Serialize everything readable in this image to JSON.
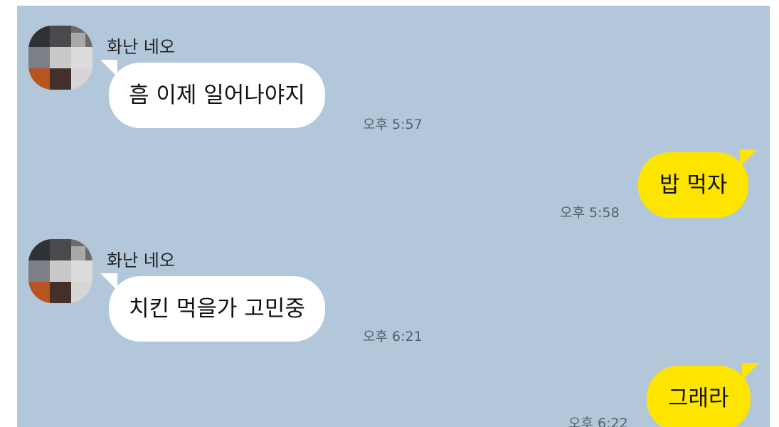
{
  "chat": {
    "messages": [
      {
        "direction": "incoming",
        "sender": "화난 네오",
        "text": "흠 이제 일어나야지",
        "time": "오후 5:57"
      },
      {
        "direction": "outgoing",
        "text": "밥 먹자",
        "time": "오후 5:58"
      },
      {
        "direction": "incoming",
        "sender": "화난 네오",
        "text": "치킨 먹을가 고민중",
        "time": "오후 6:21"
      },
      {
        "direction": "outgoing",
        "text": "그래라",
        "time": "오후 6:22"
      }
    ]
  },
  "colors": {
    "background": "#b2c7da",
    "incoming_bubble": "#ffffff",
    "outgoing_bubble": "#fee500",
    "time_text": "#56606b"
  },
  "icons": {
    "avatar": "pixelated-profile-photo"
  }
}
